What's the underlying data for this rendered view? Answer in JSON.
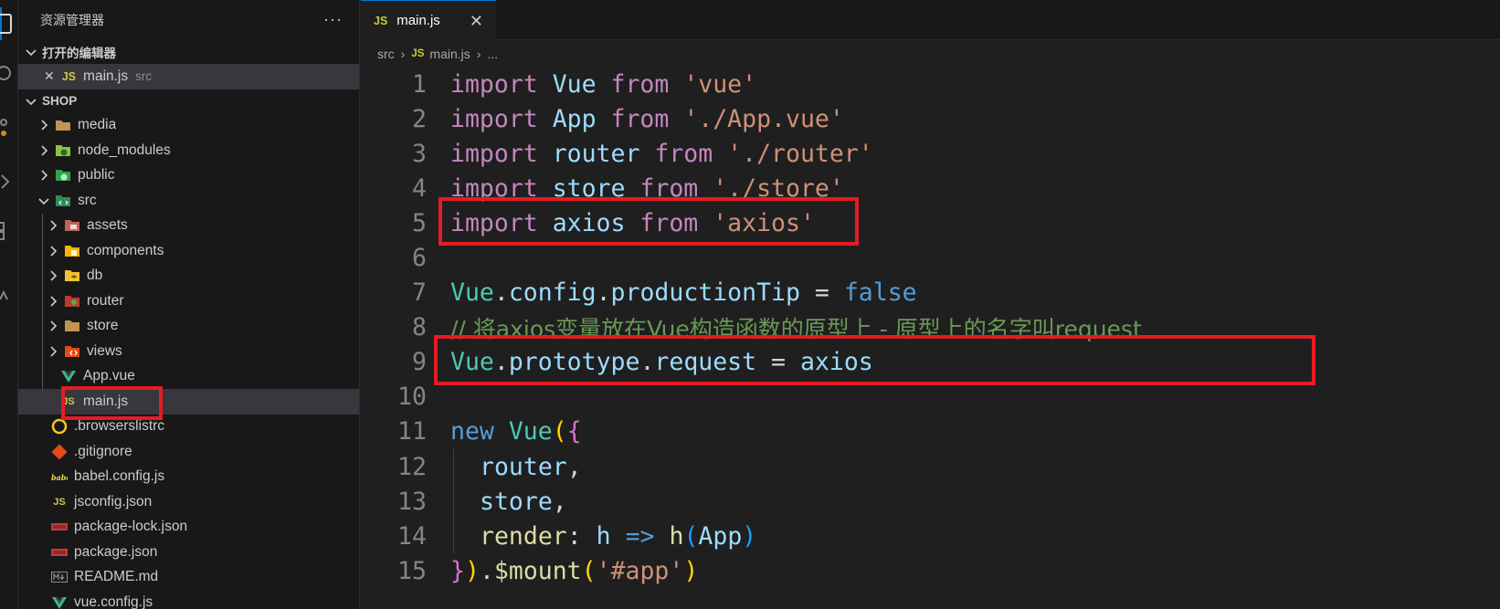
{
  "sidebar": {
    "title": "资源管理器",
    "more": "···",
    "open_editors": {
      "label": "打开的编辑器",
      "items": [
        {
          "close": "✕",
          "badge": "JS",
          "name": "main.js",
          "desc": "src"
        }
      ]
    },
    "project": {
      "label": "SHOP",
      "root_items": [
        {
          "name": "media",
          "icon": "folder-icon"
        },
        {
          "name": "node_modules",
          "icon": "node-folder-icon"
        },
        {
          "name": "public",
          "icon": "public-folder-icon"
        },
        {
          "name": "src",
          "icon": "src-folder-icon"
        }
      ],
      "src_items": [
        {
          "name": "assets",
          "icon": "assets-folder-icon"
        },
        {
          "name": "components",
          "icon": "components-folder-icon"
        },
        {
          "name": "db",
          "icon": "db-folder-icon"
        },
        {
          "name": "router",
          "icon": "router-folder-icon"
        },
        {
          "name": "store",
          "icon": "store-folder-icon"
        },
        {
          "name": "views",
          "icon": "views-folder-icon"
        },
        {
          "name": "App.vue",
          "icon": "vue-icon"
        },
        {
          "name": "main.js",
          "icon": "js-icon"
        }
      ],
      "root_files": [
        {
          "name": ".browserslistrc",
          "icon": "browserslist-icon"
        },
        {
          "name": ".gitignore",
          "icon": "git-icon"
        },
        {
          "name": "babel.config.js",
          "icon": "babel-icon"
        },
        {
          "name": "jsconfig.json",
          "icon": "js-icon"
        },
        {
          "name": "package-lock.json",
          "icon": "npm-icon"
        },
        {
          "name": "package.json",
          "icon": "npm-icon"
        },
        {
          "name": "README.md",
          "icon": "markdown-icon"
        },
        {
          "name": "vue.config.js",
          "icon": "vue-icon"
        }
      ]
    }
  },
  "editor": {
    "tab": {
      "badge": "JS",
      "label": "main.js",
      "close": "✕"
    },
    "breadcrumb": {
      "folder": "src",
      "badge": "JS",
      "file": "main.js",
      "tail": "..."
    },
    "line_numbers": [
      "1",
      "2",
      "3",
      "4",
      "5",
      "6",
      "7",
      "8",
      "9",
      "10",
      "11",
      "12",
      "13",
      "14",
      "15"
    ],
    "lines": {
      "l1": [
        "import",
        " Vue ",
        "from",
        " ",
        "'vue'"
      ],
      "l2": [
        "import",
        " App ",
        "from",
        " ",
        "'./App.vue'"
      ],
      "l3": [
        "import",
        " router ",
        "from",
        " ",
        "'./router'"
      ],
      "l4": [
        "import",
        " store ",
        "from",
        " ",
        "'./store'"
      ],
      "l5": [
        "import",
        " axios ",
        "from",
        " ",
        "'axios'"
      ],
      "l7": [
        "Vue",
        ".",
        "config",
        ".",
        "productionTip",
        " = ",
        "false"
      ],
      "l8": "// 将axios变量放在Vue构造函数的原型上 - 原型上的名字叫request",
      "l9": [
        "Vue",
        ".",
        "prototype",
        ".",
        "request",
        " = ",
        "axios"
      ],
      "l11": [
        "new",
        " ",
        "Vue",
        "(",
        "{"
      ],
      "l12": [
        "router",
        ","
      ],
      "l13": [
        "store",
        ","
      ],
      "l14": [
        "render",
        ":",
        " h ",
        "=>",
        " ",
        "h",
        "(",
        "App",
        ")"
      ],
      "l15": [
        "}",
        ")",
        ".",
        "$mount",
        "(",
        "'#app'",
        ")"
      ]
    }
  },
  "colors": {
    "keyword": "#c586c0",
    "string": "#ce9178",
    "variable": "#9cdcfe",
    "class": "#4ec9b0",
    "comment": "#6a9955",
    "highlight_box": "#e41c24"
  }
}
